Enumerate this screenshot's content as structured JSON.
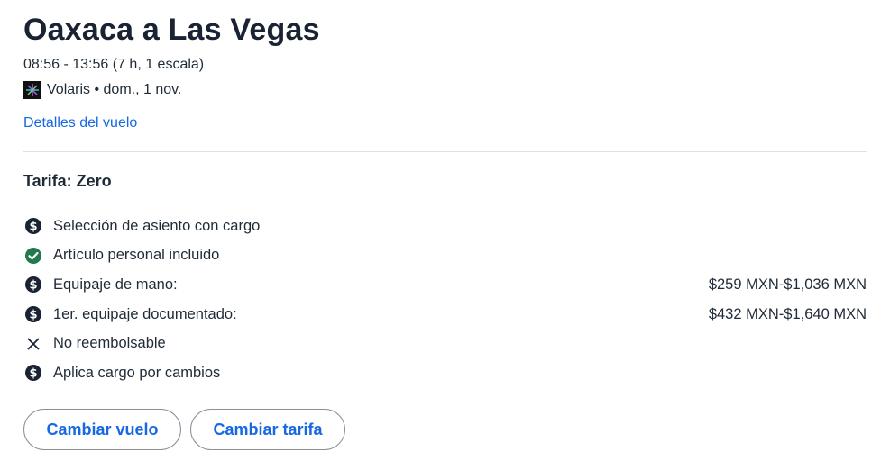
{
  "header": {
    "title": "Oaxaca a Las Vegas",
    "times": "08:56 - 13:56 (7 h, 1 escala)",
    "carrier": "Volaris • dom., 1 nov.",
    "details_link": "Detalles del vuelo"
  },
  "fare": {
    "title": "Tarifa: Zero",
    "features": [
      {
        "icon": "dollar-circle-icon",
        "label": "Selección de asiento con cargo",
        "price": ""
      },
      {
        "icon": "check-circle-icon",
        "label": "Artículo personal incluido",
        "price": ""
      },
      {
        "icon": "dollar-circle-icon",
        "label": "Equipaje de mano:",
        "price": "$259 MXN-$1,036 MXN"
      },
      {
        "icon": "dollar-circle-icon",
        "label": "1er. equipaje documentado:",
        "price": "$432 MXN-$1,640 MXN"
      },
      {
        "icon": "close-icon",
        "label": "No reembolsable",
        "price": ""
      },
      {
        "icon": "dollar-circle-icon",
        "label": "Aplica cargo por cambios",
        "price": ""
      }
    ]
  },
  "actions": {
    "change_flight": "Cambiar vuelo",
    "change_fare": "Cambiar tarifa"
  },
  "colors": {
    "link": "#1668e3",
    "check": "#227950",
    "dark": "#1a2333"
  }
}
